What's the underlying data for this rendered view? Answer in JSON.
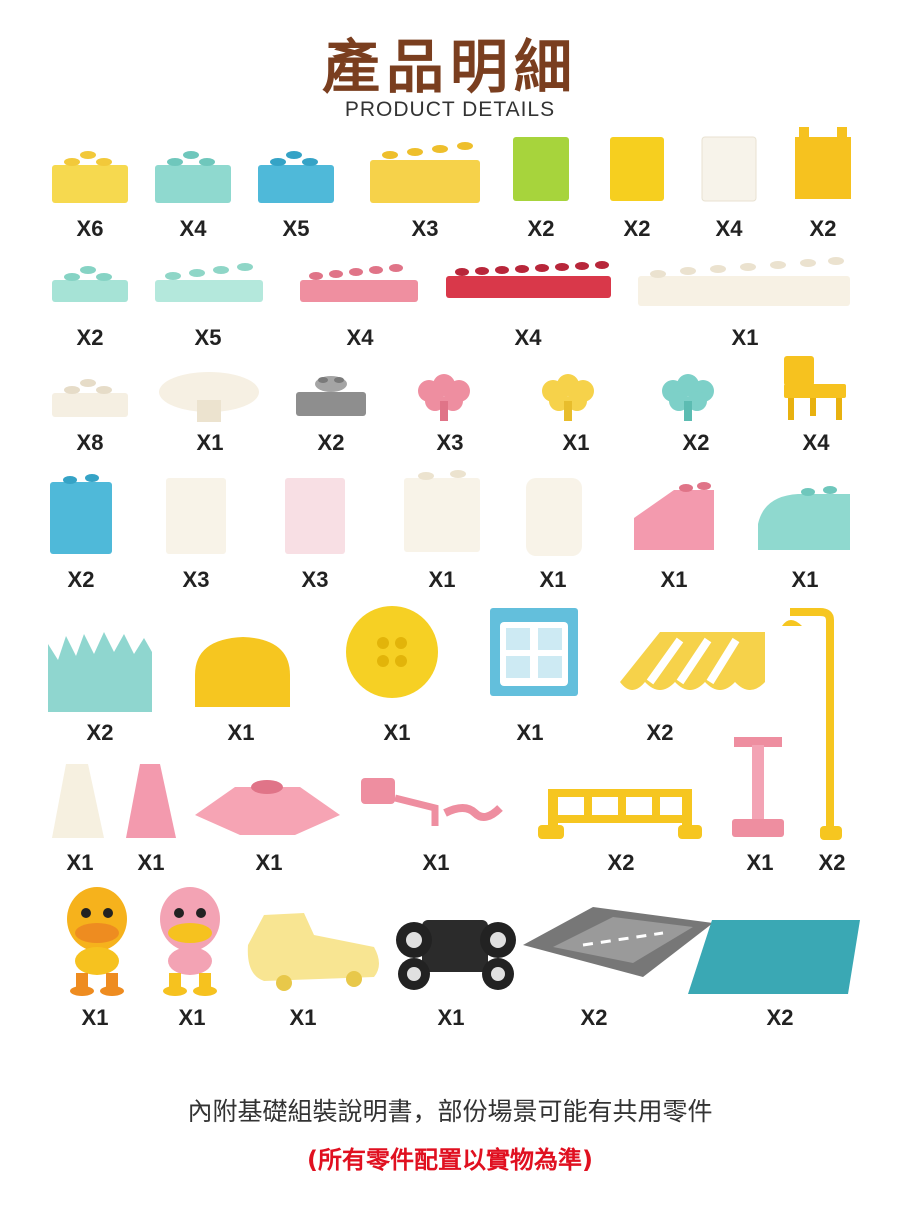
{
  "header": {
    "title": "產品明細",
    "subtitle": "PRODUCT DETAILS"
  },
  "rows": [
    [
      "X6",
      "X4",
      "X5",
      "X3",
      "X2",
      "X2",
      "X4",
      "X2"
    ],
    [
      "X2",
      "X5",
      "X4",
      "X4",
      "X1"
    ],
    [
      "X8",
      "X1",
      "X2",
      "X3",
      "X1",
      "X2",
      "X4"
    ],
    [
      "X2",
      "X3",
      "X3",
      "X1",
      "X1",
      "X1",
      "X1"
    ],
    [
      "X2",
      "X1",
      "X1",
      "X1",
      "X2"
    ],
    [
      "X1",
      "X1",
      "X1",
      "X1",
      "X2",
      "X1",
      "X2"
    ],
    [
      "X1",
      "X1",
      "X1",
      "X1",
      "X2",
      "X2"
    ]
  ],
  "footer": {
    "note": "內附基礎組裝說明書，部份場景可能有共用零件",
    "disclaimer": "(所有零件配置以實物為準)"
  },
  "colors": {
    "title": "#7a3e1f",
    "yellow": "#f6d24a",
    "mint": "#8fd9cf",
    "blue": "#4fb9d9",
    "pink": "#f3a3b4",
    "red": "#d9384a",
    "cream": "#f7f1e4",
    "grey": "#8e8e8e",
    "disclaimer": "#e01020"
  }
}
